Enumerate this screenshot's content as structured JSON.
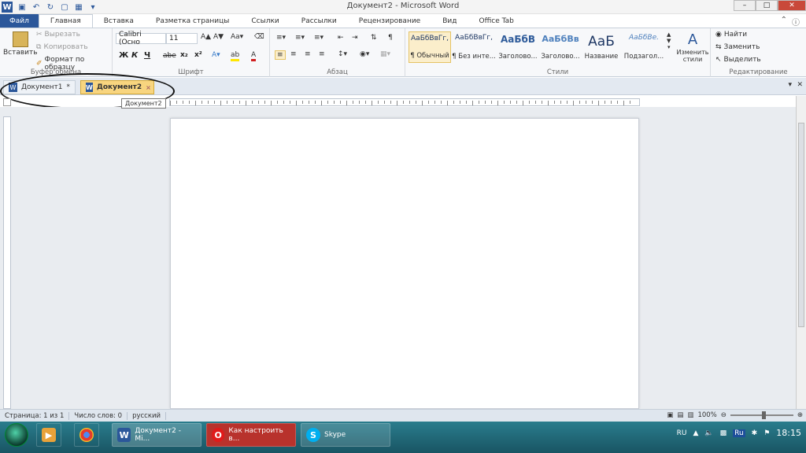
{
  "window": {
    "title": "Документ2 - Microsoft Word",
    "app_icon": "W"
  },
  "ribbon_tabs": [
    {
      "label": "Файл"
    },
    {
      "label": "Главная"
    },
    {
      "label": "Вставка"
    },
    {
      "label": "Разметка страницы"
    },
    {
      "label": "Ссылки"
    },
    {
      "label": "Рассылки"
    },
    {
      "label": "Рецензирование"
    },
    {
      "label": "Вид"
    },
    {
      "label": "Office Tab"
    }
  ],
  "clipboard": {
    "paste": "Вставить",
    "cut": "Вырезать",
    "copy": "Копировать",
    "format_painter": "Формат по образцу",
    "group": "Буфер обмена"
  },
  "font": {
    "name": "Calibri (Осно",
    "size": "11",
    "bold": "Ж",
    "italic": "К",
    "underline": "Ч",
    "strike": "abe",
    "subscript": "x₂",
    "superscript": "x²",
    "group": "Шрифт"
  },
  "paragraph": {
    "group": "Абзац"
  },
  "styles": {
    "group": "Стили",
    "items": [
      {
        "sample": "АаБбВвГг,",
        "name": "¶ Обычный"
      },
      {
        "sample": "АаБбВвГг,",
        "name": "¶ Без инте..."
      },
      {
        "sample": "АаБбВ",
        "name": "Заголово..."
      },
      {
        "sample": "АаБбВв",
        "name": "Заголово..."
      },
      {
        "sample": "АаБ",
        "name": "Название"
      },
      {
        "sample": "АаБбВе.",
        "name": "Подзагол..."
      }
    ],
    "change_styles": "Изменить стили"
  },
  "editing": {
    "find": "Найти",
    "replace": "Заменить",
    "select": "Выделить",
    "group": "Редактирование"
  },
  "doc_tabs": [
    {
      "label": "Документ1",
      "modified": "*"
    },
    {
      "label": "Документ2",
      "close": "×"
    }
  ],
  "tooltip": "Документ2",
  "status": {
    "page": "Страница: 1 из 1",
    "words": "Число слов: 0",
    "language": "русский",
    "zoom": "100%"
  },
  "taskbar": {
    "word": "Документ2 - Mi...",
    "opera": "Как настроить в...",
    "skype": "Skype",
    "lang": "RU",
    "tray_lang": "Ru",
    "clock": "18:15"
  },
  "colors": {
    "word_blue": "#2b579a",
    "active_tab": "#f8d57f",
    "taskbar": "#1f6b7a",
    "opera": "#b8322c"
  }
}
